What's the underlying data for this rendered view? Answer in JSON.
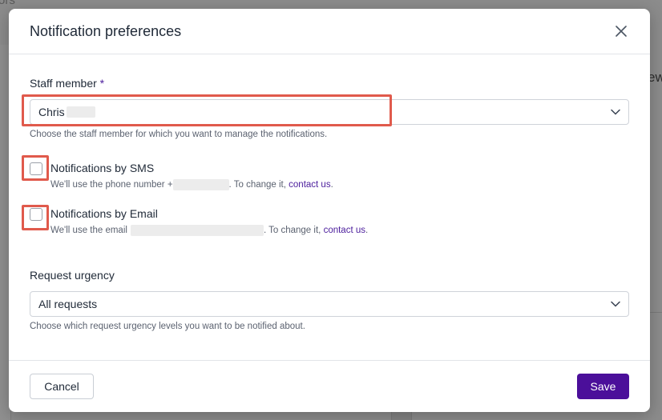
{
  "background": {
    "top_text": "ors",
    "right_text": "ew"
  },
  "modal": {
    "title": "Notification preferences",
    "close_icon": "close-icon"
  },
  "staff_member": {
    "label": "Staff member",
    "required_mark": "*",
    "value": "Chris",
    "help": "Choose the staff member for which you want to manage the notifications."
  },
  "sms": {
    "label": "Notifications by SMS",
    "checked": false,
    "help_prefix": "We'll use the phone number +",
    "help_suffix": ". To change it,",
    "link": "contact us",
    "end": "."
  },
  "email": {
    "label": "Notifications by Email",
    "checked": false,
    "help_prefix": "We'll use the email",
    "help_suffix": ". To change it,",
    "link": "contact us",
    "end": "."
  },
  "urgency": {
    "label": "Request urgency",
    "value": "All requests",
    "help": "Choose which request urgency levels you want to be notified about."
  },
  "footer": {
    "cancel_label": "Cancel",
    "save_label": "Save"
  },
  "colors": {
    "accent": "#4b0f9a",
    "highlight": "#e05a4c",
    "link": "#4b1d9c"
  }
}
